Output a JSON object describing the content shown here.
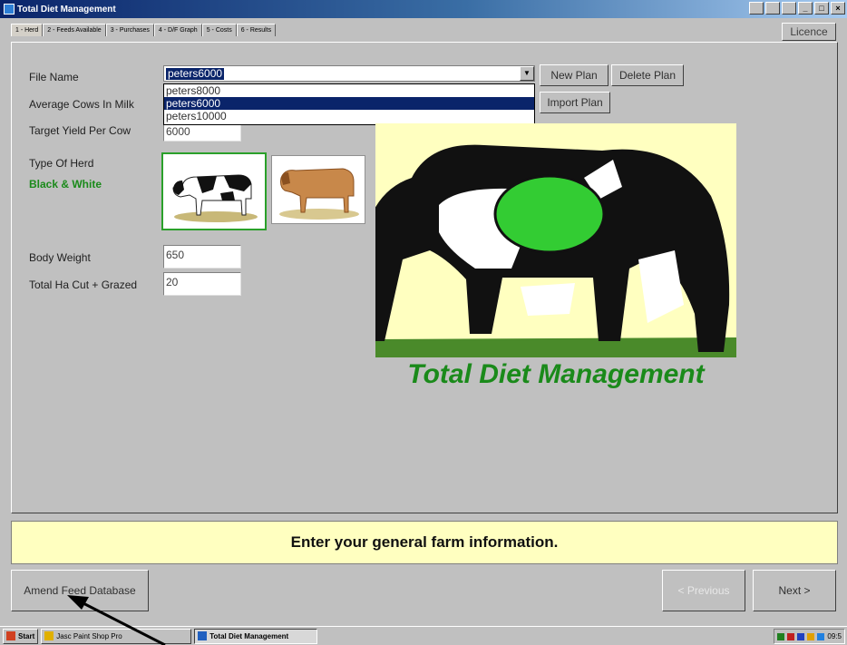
{
  "window": {
    "title": "Total Diet Management"
  },
  "tabs": [
    {
      "label": "1 - Herd"
    },
    {
      "label": "2 - Feeds Available"
    },
    {
      "label": "3 - Purchases"
    },
    {
      "label": "4 - D/F Graph"
    },
    {
      "label": "5 - Costs"
    },
    {
      "label": "6 - Results"
    }
  ],
  "licence_label": "Licence",
  "form": {
    "file_name_label": "File Name",
    "file_name_value": "peters6000",
    "file_options": [
      "peters8000",
      "peters6000",
      "peters10000"
    ],
    "avg_cows_label": "Average Cows In Milk",
    "target_yield_label": "Target Yield Per Cow",
    "target_yield_value": "6000",
    "herd_type_label": "Type Of Herd",
    "herd_type_value": "Black & White",
    "body_weight_label": "Body Weight",
    "body_weight_value": "650",
    "total_ha_label": "Total Ha Cut + Grazed",
    "total_ha_value": "20"
  },
  "buttons": {
    "new_plan": "New Plan",
    "delete_plan": "Delete Plan",
    "import_plan": "Import Plan",
    "amend_feed_db": "Amend Feed Database",
    "previous": "< Previous",
    "next": "Next >"
  },
  "logo_title": "Total Diet Management",
  "status_message": "Enter your general farm information.",
  "taskbar": {
    "start": "Start",
    "items": [
      "Jasc Paint Shop Pro",
      "Total Diet Management"
    ],
    "clock": "09:5"
  },
  "colors": {
    "accent_green": "#1a8a1a",
    "status_bg": "#ffffc0",
    "selection": "#0a246a"
  }
}
